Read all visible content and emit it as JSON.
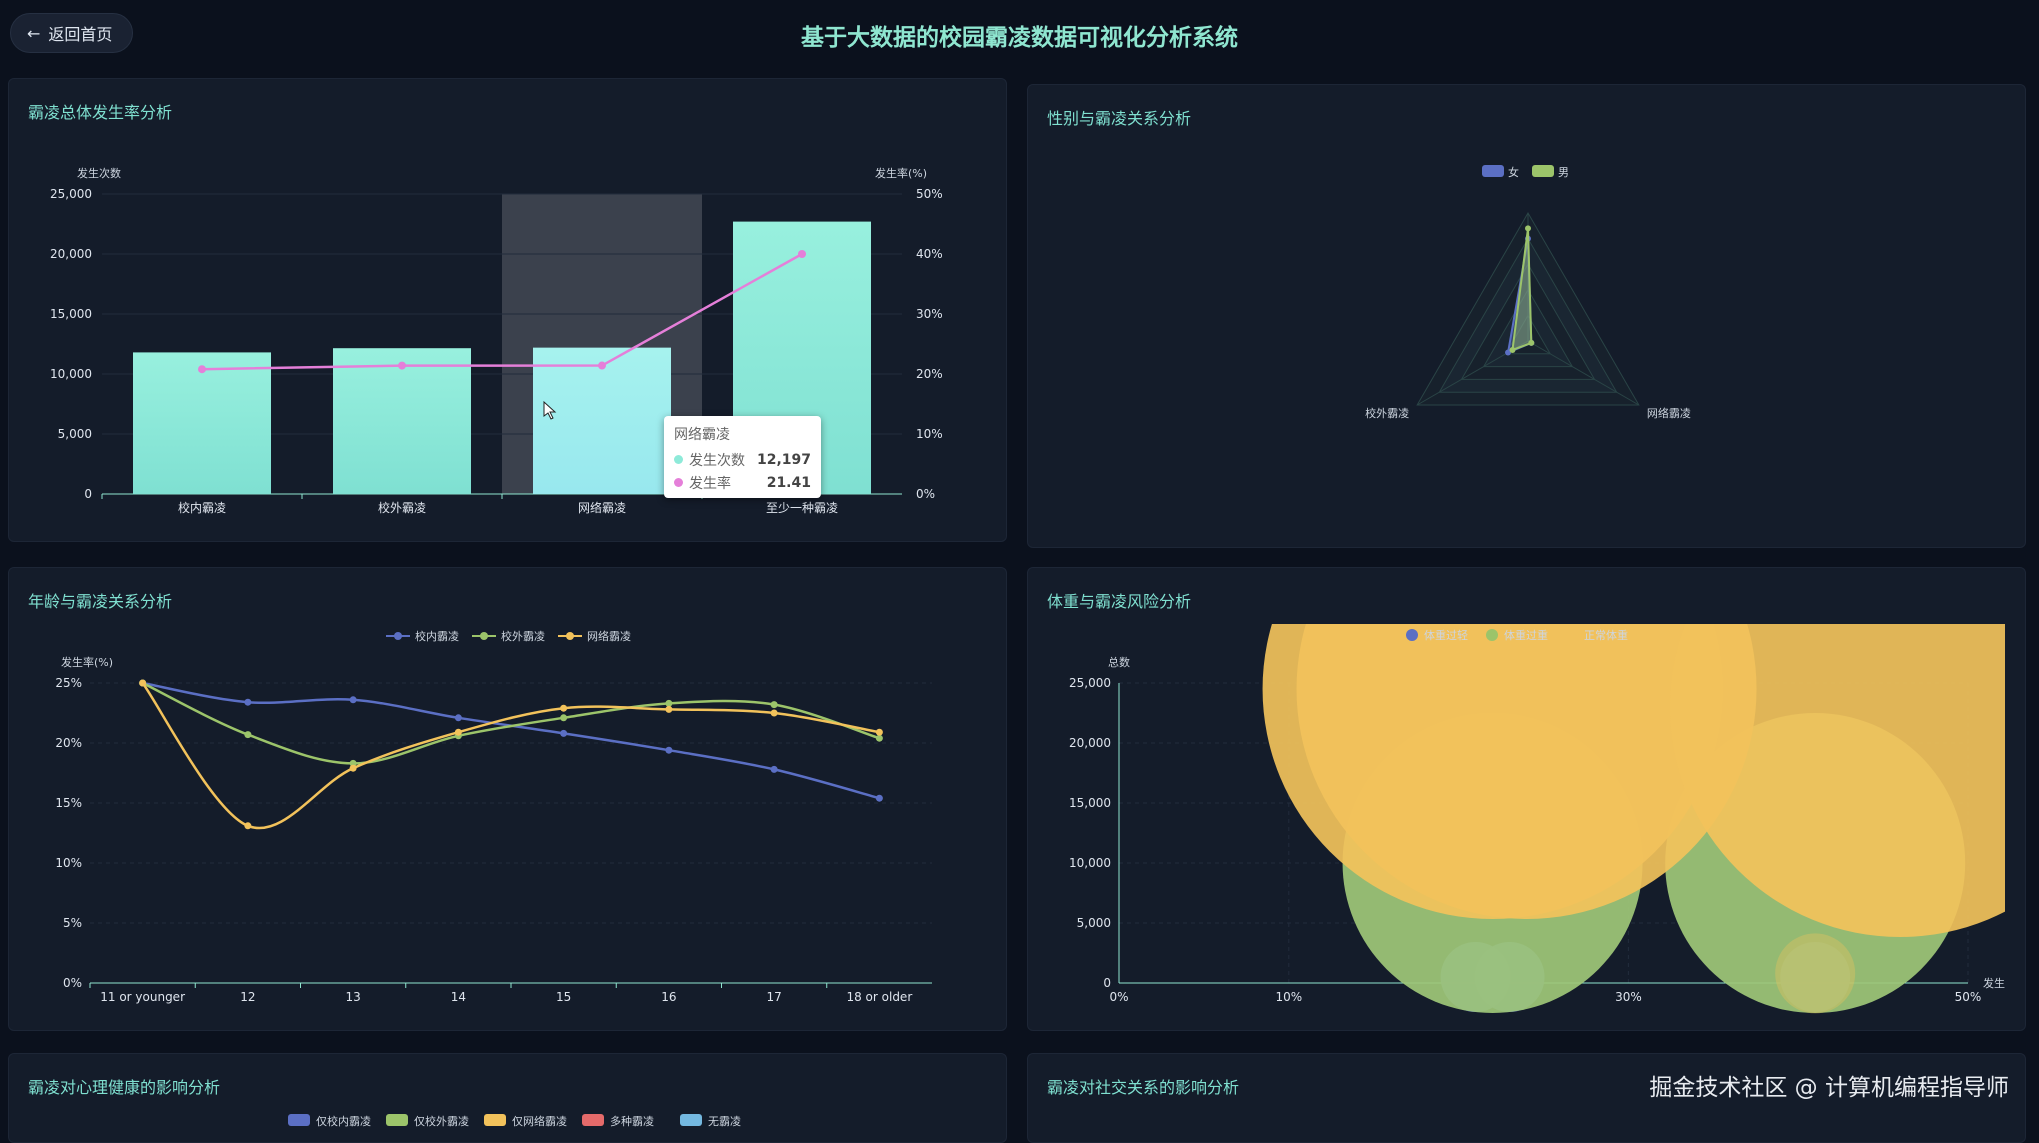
{
  "header": {
    "back_label": "返回首页",
    "title": "基于大数据的校园霸凌数据可视化分析系统"
  },
  "panels": {
    "overall": "霸凌总体发生率分析",
    "gender": "性别与霸凌关系分析",
    "age": "年龄与霸凌关系分析",
    "weight": "体重与霸凌风险分析",
    "mental": "霸凌对心理健康的影响分析",
    "social": "霸凌对社交关系的影响分析"
  },
  "tooltip": {
    "title": "网络霸凌",
    "rows": [
      {
        "label": "发生次数",
        "value": "12,197",
        "color": "#8eead9"
      },
      {
        "label": "发生率",
        "value": "21.41",
        "color": "#e57fd9"
      }
    ]
  },
  "watermark": "掘金技术社区 @ 计算机编程指导师",
  "colors": {
    "teal": "#8eead9",
    "pink": "#e57fd9",
    "blue": "#5b6fc4",
    "green": "#9cc46a",
    "yellow": "#f2c25b",
    "red": "#e46a6a",
    "lightblue": "#74b8e0"
  },
  "chart_data": [
    {
      "type": "bar",
      "title": "霸凌总体发生率分析",
      "categories": [
        "校内霸凌",
        "校外霸凌",
        "网络霸凌",
        "至少一种霸凌"
      ],
      "series": [
        {
          "name": "发生次数",
          "type": "bar",
          "values": [
            11800,
            12150,
            12197,
            22700
          ]
        },
        {
          "name": "发生率",
          "type": "line",
          "axis": "right",
          "values": [
            20.8,
            21.4,
            21.41,
            40.0
          ]
        }
      ],
      "ylabel": "发生次数",
      "ylabel_right": "发生率(%)",
      "ylim": [
        0,
        25000
      ],
      "ylim_right": [
        0,
        50
      ],
      "yticks": [
        "0",
        "5,000",
        "10,000",
        "15,000",
        "20,000",
        "25,000"
      ],
      "yticks_right": [
        "0%",
        "10%",
        "20%",
        "30%",
        "40%",
        "50%"
      ],
      "highlight": "网络霸凌"
    },
    {
      "type": "radar",
      "title": "性别与霸凌关系分析",
      "indicators": [
        "",
        "校外霸凌",
        "网络霸凌"
      ],
      "series": [
        {
          "name": "女",
          "values": [
            0.8,
            0.18,
            0.03
          ]
        },
        {
          "name": "男",
          "values": [
            0.88,
            0.14,
            0.03
          ]
        }
      ]
    },
    {
      "type": "line",
      "title": "年龄与霸凌关系分析",
      "categories": [
        "11 or younger",
        "12",
        "13",
        "14",
        "15",
        "16",
        "17",
        "18 or older"
      ],
      "series": [
        {
          "name": "校内霸凌",
          "values": [
            25.0,
            23.4,
            23.6,
            22.1,
            20.8,
            19.4,
            17.8,
            15.4
          ]
        },
        {
          "name": "校外霸凌",
          "values": [
            25.0,
            20.7,
            18.3,
            20.6,
            22.1,
            23.3,
            23.2,
            20.4
          ]
        },
        {
          "name": "网络霸凌",
          "values": [
            25.0,
            13.1,
            17.9,
            20.9,
            22.9,
            22.8,
            22.5,
            20.9
          ]
        }
      ],
      "ylabel": "发生率(%)",
      "ylim": [
        0,
        25
      ],
      "yticks": [
        "0%",
        "5%",
        "10%",
        "15%",
        "20%",
        "25%"
      ]
    },
    {
      "type": "scatter",
      "title": "体重与霸凌风险分析",
      "legend": [
        "体重过轻",
        "体重过重",
        "正常体重"
      ],
      "xlabel": "发生",
      "ylabel": "总数",
      "ylim": [
        0,
        25000
      ],
      "xlim": [
        0,
        50
      ],
      "yticks": [
        "0",
        "5,000",
        "10,000",
        "15,000",
        "20,000",
        "25,000"
      ],
      "xticks": [
        {
          "value": 0,
          "label": "0%"
        },
        {
          "value": 10,
          "label": "10%"
        },
        {
          "value": 30,
          "label": "30%"
        },
        {
          "value": 50,
          "label": "50%"
        }
      ],
      "series": [
        {
          "name": "体重过轻",
          "points": [
            [
              21,
              500
            ],
            [
              23,
              500
            ],
            [
              41,
              500
            ]
          ]
        },
        {
          "name": "体重过重",
          "points": [
            [
              22,
              10000
            ],
            [
              41,
              10000
            ]
          ]
        },
        {
          "name": "正常体重",
          "points": [
            [
              22,
              24500
            ],
            [
              24,
              24500
            ],
            [
              46,
              23000
            ],
            [
              41,
              800
            ]
          ]
        }
      ]
    },
    {
      "type": "bar",
      "title": "霸凌对心理健康的影响分析",
      "legend": [
        "仅校内霸凌",
        "仅校外霸凌",
        "仅网络霸凌",
        "多种霸凌",
        "无霸凌"
      ]
    }
  ]
}
